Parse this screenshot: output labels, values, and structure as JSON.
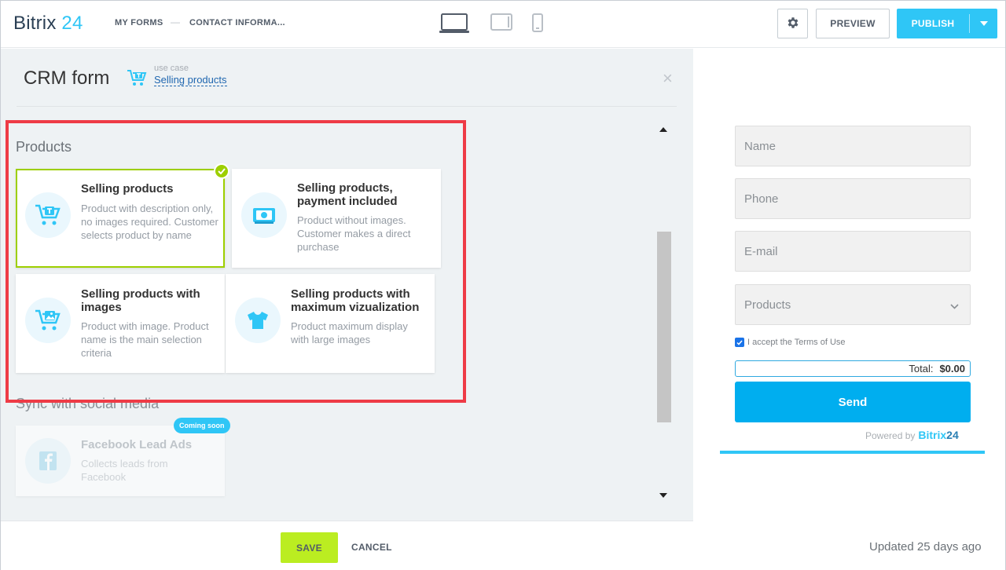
{
  "header": {
    "logo_main": "Bitrix",
    "logo_num": "24",
    "breadcrumb": [
      "MY FORMS",
      "CONTACT INFORMA..."
    ],
    "breadcrumb_sep": "—",
    "preview_label": "PREVIEW",
    "publish_label": "PUBLISH"
  },
  "panel": {
    "title": "CRM form",
    "use_case_label": "use case",
    "use_case_value": "Selling products",
    "close_glyph": "×"
  },
  "sections": {
    "products": {
      "title": "Products",
      "cards": [
        {
          "title": "Selling products",
          "desc": "Product with description only, no images required. Customer selects product by name",
          "selected": true
        },
        {
          "title": "Selling products, payment included",
          "desc": "Product without images. Customer makes a direct purchase",
          "selected": false
        },
        {
          "title": "Selling products with images",
          "desc": "Product with image. Product name is the main selection criteria",
          "selected": false
        },
        {
          "title": "Selling products with maximum vizualization",
          "desc": "Product maximum display with large images",
          "selected": false
        }
      ]
    },
    "social": {
      "title": "Sync with social media",
      "card": {
        "title": "Facebook Lead Ads",
        "desc": "Collects leads from Facebook",
        "badge": "Coming soon"
      }
    }
  },
  "footer": {
    "save_label": "SAVE",
    "cancel_label": "CANCEL"
  },
  "preview_form": {
    "name_placeholder": "Name",
    "phone_placeholder": "Phone",
    "email_placeholder": "E-mail",
    "products_placeholder": "Products",
    "terms_text": "I accept the Terms of Use",
    "terms_checked": true,
    "total_label": "Total:",
    "total_value": "$0.00",
    "send_label": "Send",
    "powered_by": "Powered by",
    "brand_main": "Bitrix",
    "brand_num": "24"
  },
  "status": {
    "updated_text": "Updated 25 days ago"
  },
  "colors": {
    "accent": "#2fc6f6",
    "save_green": "#bbed21",
    "selected_border": "#9dcf00",
    "highlight_red": "#ee3b46",
    "send_blue": "#00aeef"
  },
  "icons": {
    "settings": "gear-icon",
    "desktop": "desktop-icon",
    "tablet": "tablet-icon",
    "mobile": "mobile-icon",
    "publish_menu": "caret-down-icon",
    "close": "close-icon",
    "products_select": "chevron-down-icon"
  }
}
